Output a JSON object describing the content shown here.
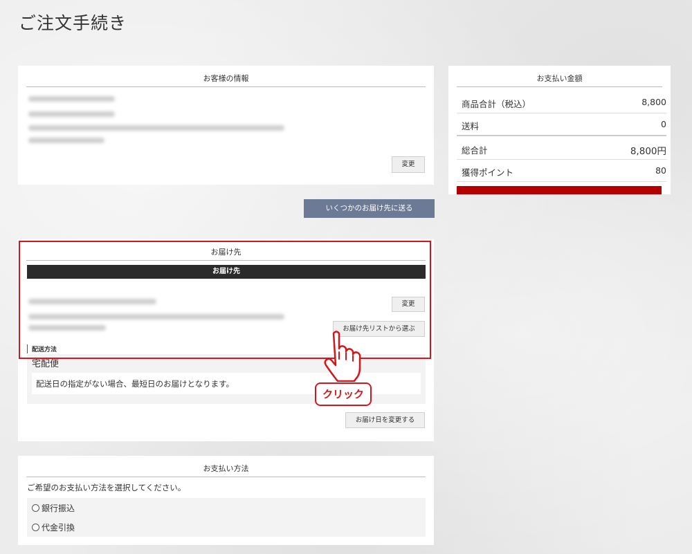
{
  "page": {
    "title": "ご注文手続き"
  },
  "customer": {
    "heading": "お客様の情報",
    "change_label": "変更"
  },
  "summary": {
    "heading": "お支払い金額",
    "rows": [
      {
        "label": "商品合計（税込）",
        "value": "8,800"
      },
      {
        "label": "送料",
        "value": "0"
      },
      {
        "label": "総合計",
        "value": "8,800円"
      },
      {
        "label": "獲得ポイント",
        "value": "80"
      }
    ],
    "accent_color": "#b30000"
  },
  "multi_ship_button": "いくつかのお届け先に送る",
  "delivery": {
    "heading": "お届け先",
    "bar_label": "お届け先",
    "change_label": "変更",
    "choose_list_label": "お届け先リストから選ぶ",
    "method_label": "配送方法",
    "method_value": "宅配便",
    "note": "配送日の指定がない場合、最短日のお届けとなります。",
    "change_date_label": "お届け日を変更する"
  },
  "payment": {
    "heading": "お支払い方法",
    "prompt": "ご希望のお支払い方法を選択してください。",
    "options": [
      {
        "label": "銀行振込"
      },
      {
        "label": "代金引換"
      }
    ]
  },
  "annotation": {
    "click_label": "クリック",
    "color": "#d8141a"
  }
}
